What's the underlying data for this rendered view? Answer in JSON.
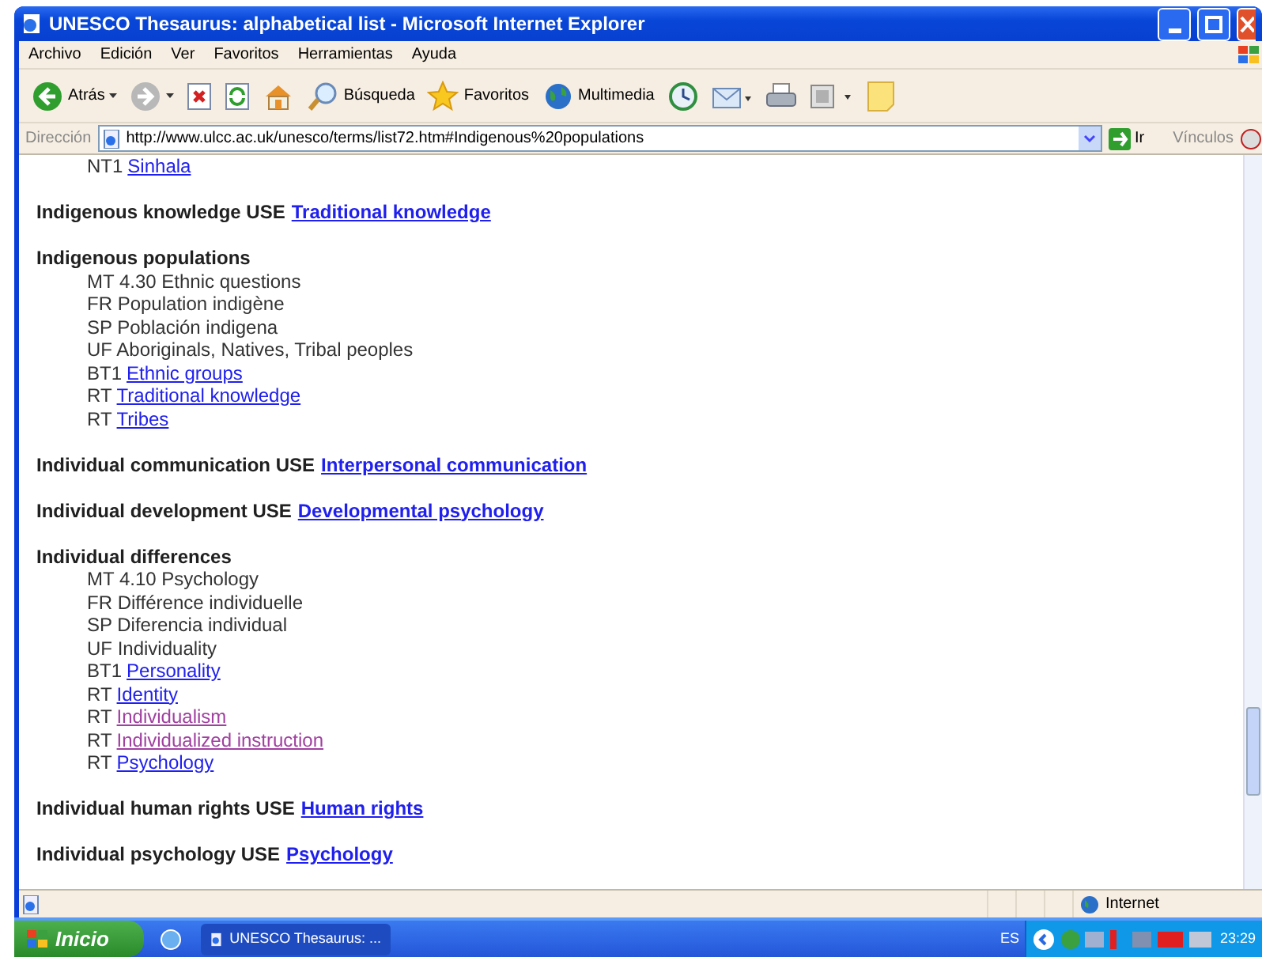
{
  "window": {
    "title": "UNESCO Thesaurus: alphabetical list - Microsoft Internet Explorer"
  },
  "menu": [
    "Archivo",
    "Edición",
    "Ver",
    "Favoritos",
    "Herramientas",
    "Ayuda"
  ],
  "toolbar": [
    {
      "kind": "back",
      "label": "Atrás"
    },
    {
      "kind": "forward"
    },
    {
      "kind": "stop"
    },
    {
      "kind": "refresh"
    },
    {
      "kind": "home"
    },
    {
      "kind": "search",
      "label": "Búsqueda"
    },
    {
      "kind": "favorites",
      "label": "Favoritos"
    },
    {
      "kind": "media",
      "label": "Multimedia"
    },
    {
      "kind": "history"
    },
    {
      "kind": "mail"
    },
    {
      "kind": "print"
    },
    {
      "kind": "edit"
    },
    {
      "kind": "note"
    }
  ],
  "address": {
    "label": "Dirección",
    "url": "http://www.ulcc.ac.uk/unesco/terms/list72.htm#Indigenous%20populations",
    "go": "Ir",
    "links": "Vínculos"
  },
  "entries": [
    {
      "relations": [
        {
          "code": "NT1",
          "link": {
            "label": "Sinhala",
            "visited": false
          }
        }
      ]
    },
    {
      "term": "Indigenous knowledge USE",
      "use": {
        "label": "Traditional knowledge",
        "visited": false
      }
    },
    {
      "term": "Indigenous populations",
      "relations": [
        {
          "code": "MT 4.30 Ethnic questions"
        },
        {
          "code": "FR Population indigène"
        },
        {
          "code": "SP Población indigena"
        },
        {
          "code": "UF Aboriginals, Natives, Tribal peoples"
        },
        {
          "code": "BT1",
          "link": {
            "label": "Ethnic groups",
            "visited": false
          }
        },
        {
          "code": "RT",
          "link": {
            "label": "Traditional knowledge",
            "visited": false
          }
        },
        {
          "code": "RT",
          "link": {
            "label": "Tribes",
            "visited": false
          }
        }
      ]
    },
    {
      "term": "Individual communication USE",
      "use": {
        "label": "Interpersonal communication",
        "visited": false
      }
    },
    {
      "term": "Individual development USE",
      "use": {
        "label": "Developmental psychology",
        "visited": false
      }
    },
    {
      "term": "Individual differences",
      "relations": [
        {
          "code": "MT 4.10 Psychology"
        },
        {
          "code": "FR Différence individuelle"
        },
        {
          "code": "SP Diferencia individual"
        },
        {
          "code": "UF Individuality"
        },
        {
          "code": "BT1",
          "link": {
            "label": "Personality",
            "visited": false
          }
        },
        {
          "code": "RT",
          "link": {
            "label": "Identity",
            "visited": false
          }
        },
        {
          "code": "RT",
          "link": {
            "label": "Individualism",
            "visited": true
          }
        },
        {
          "code": "RT",
          "link": {
            "label": "Individualized instruction",
            "visited": true
          }
        },
        {
          "code": "RT",
          "link": {
            "label": "Psychology",
            "visited": false
          }
        }
      ]
    },
    {
      "term": "Individual human rights USE",
      "use": {
        "label": "Human rights",
        "visited": false
      }
    },
    {
      "term": "Individual psychology USE",
      "use": {
        "label": "Psychology",
        "visited": false
      }
    }
  ],
  "status_bar": {
    "zone": "Internet"
  },
  "taskbar": {
    "start": "Inicio",
    "task": "UNESCO Thesaurus: ...",
    "language": "ES",
    "clock": "23:29"
  }
}
